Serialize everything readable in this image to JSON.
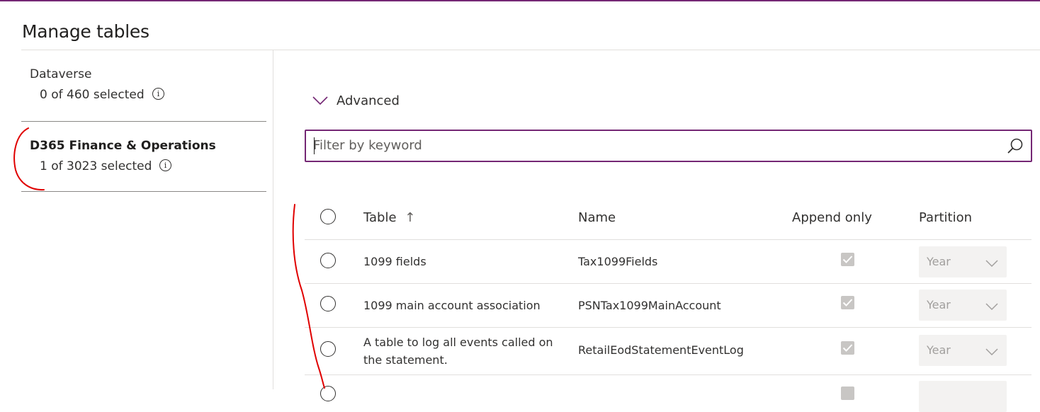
{
  "page": {
    "title": "Manage tables"
  },
  "sources": [
    {
      "name": "Dataverse",
      "count": "0 of 460 selected",
      "info_icon": "info-icon",
      "selected": false
    },
    {
      "name": "D365 Finance & Operations",
      "count": "1 of 3023 selected",
      "info_icon": "info-icon",
      "selected": true
    }
  ],
  "advanced": {
    "label": "Advanced",
    "icon": "chevron-down-icon"
  },
  "filter": {
    "placeholder": "Filter by keyword",
    "value": "",
    "icon": "search-icon"
  },
  "table": {
    "columns": {
      "table": "Table",
      "sort_indicator": "↑",
      "name": "Name",
      "append_only": "Append only",
      "partition": "Partition"
    },
    "rows": [
      {
        "table": "1099 fields",
        "name": "Tax1099Fields",
        "append_only": true,
        "partition": "Year"
      },
      {
        "table": "1099 main account association",
        "name": "PSNTax1099MainAccount",
        "append_only": true,
        "partition": "Year"
      },
      {
        "table": "A table to log all events called on the statement.",
        "name": "RetailEodStatementEventLog",
        "append_only": true,
        "partition": "Year"
      }
    ]
  },
  "colors": {
    "accent": "#742774",
    "annotation": "#e00000",
    "divider": "#e1dfdd"
  }
}
